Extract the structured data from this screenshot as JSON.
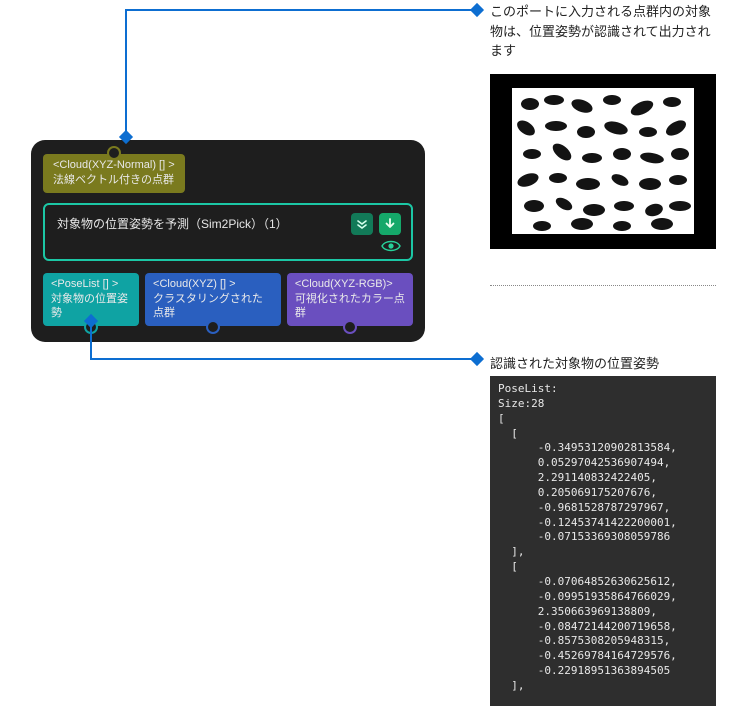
{
  "callouts": {
    "input_desc": "このポートに入力される点群内の対象物は、位置姿勢が認識されて出力されます",
    "output_desc": "認識された対象物の位置姿勢"
  },
  "node": {
    "input_port": {
      "type_line": "<Cloud(XYZ-Normal) [] >",
      "label": "法線ベクトル付きの点群"
    },
    "title": "対象物の位置姿勢を予測（Sim2Pick）（1）",
    "output_ports": {
      "pose": {
        "type_line": "<PoseList [] >",
        "label": "対象物の位置姿勢"
      },
      "cluster": {
        "type_line": "<Cloud(XYZ) [] >",
        "label": "クラスタリングされた点群"
      },
      "color": {
        "type_line": "<Cloud(XYZ-RGB)>",
        "label": "可視化されたカラー点群"
      }
    }
  },
  "poselist": {
    "header": "PoseList:",
    "size_label": "Size:28",
    "open_bracket": "[",
    "entry_open": "  [",
    "entry_close": "  ],",
    "entries": [
      [
        "-0.34953120902813584,",
        "0.05297042536907494,",
        "2.291140832422405,",
        "0.205069175207676,",
        "-0.9681528787297967,",
        "-0.12453741422200001,",
        "-0.07153369308059786"
      ],
      [
        "-0.07064852630625612,",
        "-0.09951935864766029,",
        "2.350663969138809,",
        "-0.08472144200719658,",
        "-0.8575308205948315,",
        "-0.45269784164729576,",
        "-0.22918951363894505"
      ]
    ]
  }
}
